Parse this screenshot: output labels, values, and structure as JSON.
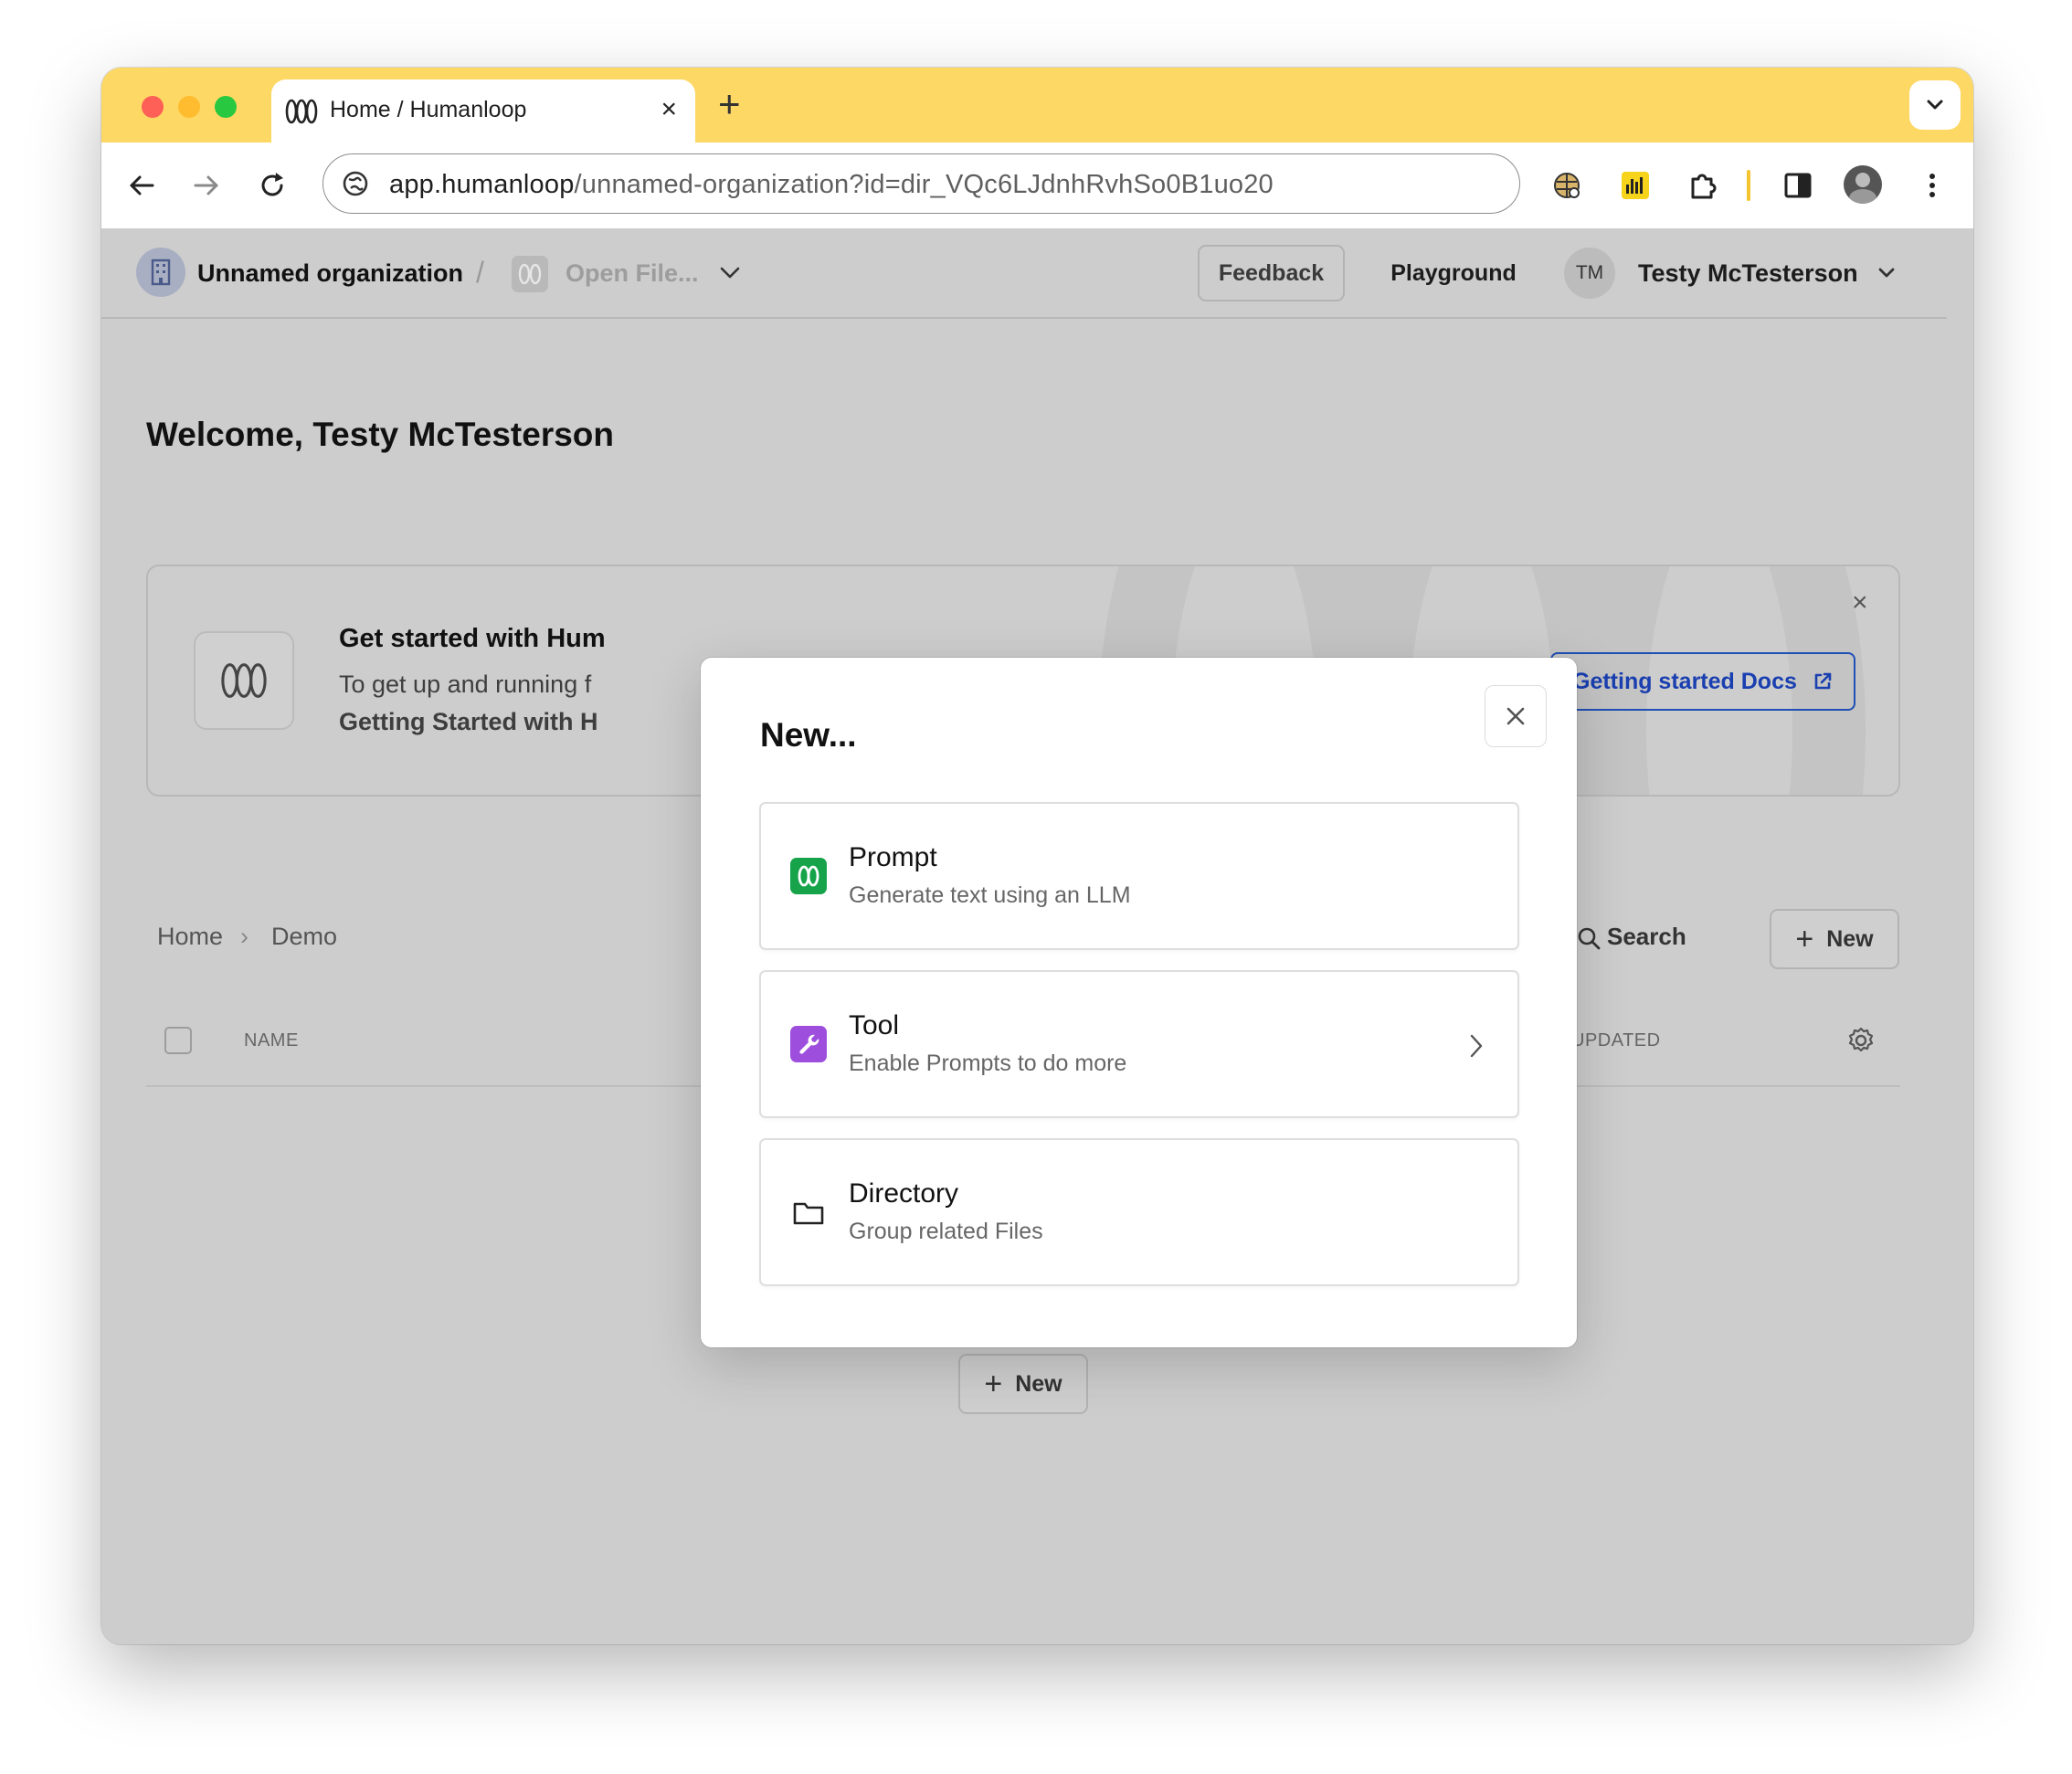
{
  "browser": {
    "tab_title": "Home / Humanloop",
    "tab_close": "×",
    "new_tab": "+",
    "url_host": "app.humanloop",
    "url_path": "/unnamed-organization?id=dir_VQc6LJdnhRvhSo0B1uo20",
    "traffic_colors": [
      "#fe5f57",
      "#febc2e",
      "#28c840"
    ]
  },
  "header": {
    "org_name": "Unnamed organization",
    "separator": "/",
    "open_file": "Open File...",
    "feedback": "Feedback",
    "playground": "Playground",
    "user_initials": "TM",
    "user_name": "Testy McTesterson"
  },
  "main": {
    "welcome": "Welcome, Testy McTesterson",
    "banner": {
      "title": "Get started with Hum",
      "description": "To get up and running f",
      "link": "Getting Started with H",
      "docs_button": "Getting started Docs",
      "close": "×"
    },
    "breadcrumb": {
      "home": "Home",
      "separator": "›",
      "current": "Demo"
    },
    "search": "Search",
    "new_top": "New",
    "new_bottom": "New",
    "table": {
      "col_name": "NAME",
      "col_updated": "UPDATED"
    }
  },
  "modal": {
    "title": "New...",
    "options": [
      {
        "title": "Prompt",
        "subtitle": "Generate text using an LLM",
        "icon": "humanloop-logo-icon",
        "color": "#16a34a"
      },
      {
        "title": "Tool",
        "subtitle": "Enable Prompts to do more",
        "icon": "wrench-icon",
        "color": "#9d4edd"
      },
      {
        "title": "Directory",
        "subtitle": "Group related Files",
        "icon": "folder-icon"
      }
    ]
  }
}
